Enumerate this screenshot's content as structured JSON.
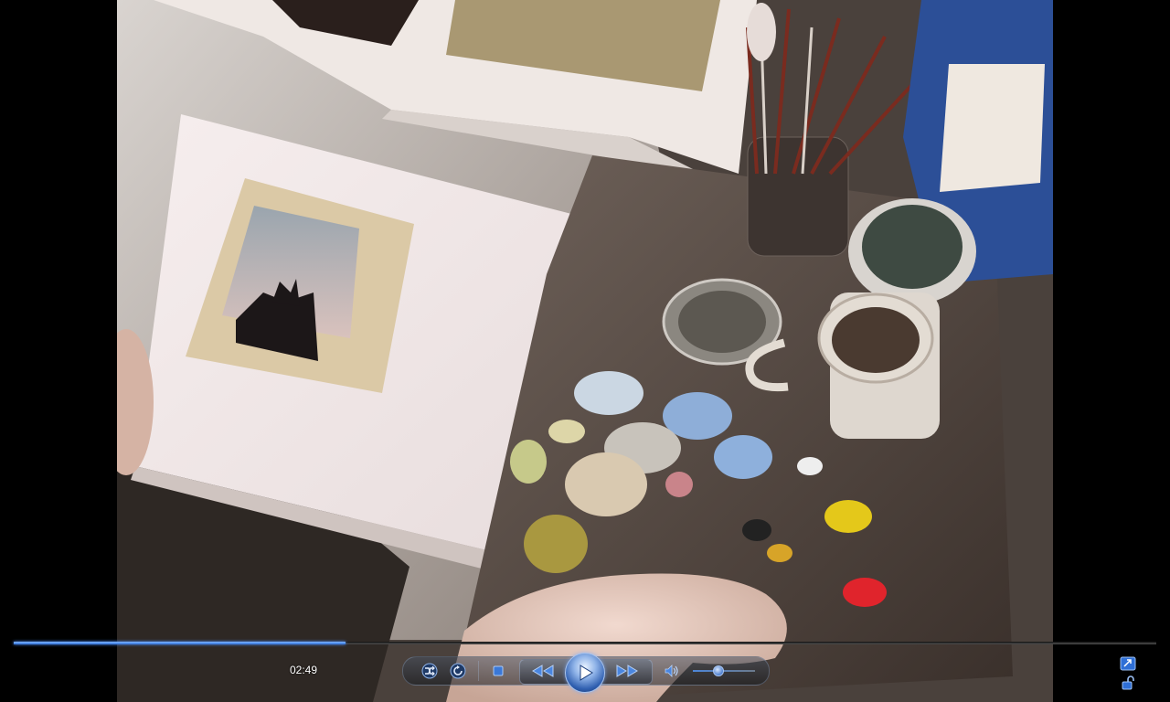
{
  "player": {
    "time": "02:49",
    "progress": 0.29,
    "volume": 0.4,
    "accent_color": "#3a78d8"
  },
  "controls": {
    "shuffle_icon": "shuffle-icon",
    "repeat_icon": "repeat-icon",
    "stop_icon": "stop-icon",
    "previous_icon": "rewind-icon",
    "play_icon": "play-icon",
    "next_icon": "fast-forward-icon",
    "mute_icon": "speaker-icon",
    "switch_icon": "switch-to-library-icon",
    "lock_icon": "lock-icon"
  }
}
